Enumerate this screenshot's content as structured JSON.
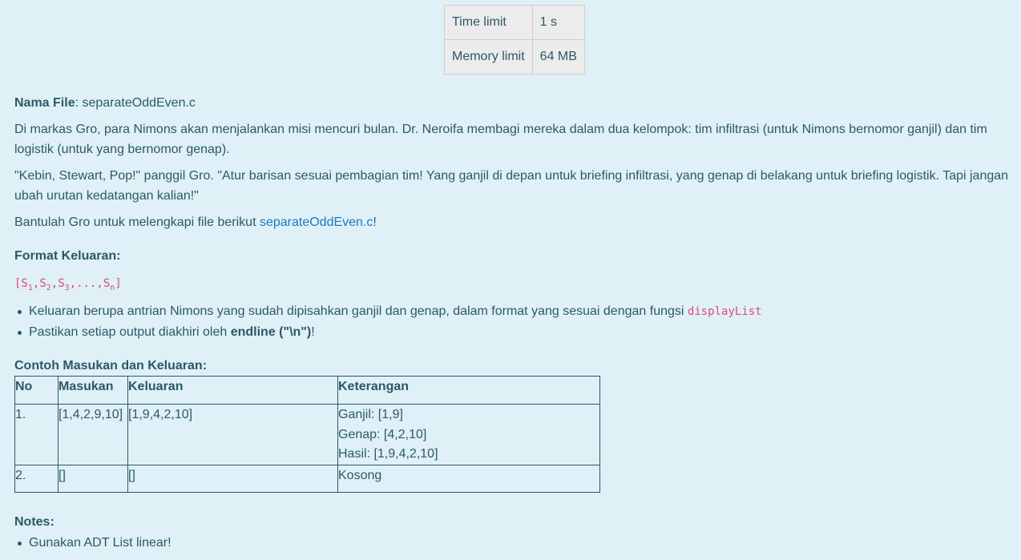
{
  "limits": {
    "time_label": "Time limit",
    "time_value": "1 s",
    "memory_label": "Memory limit",
    "memory_value": "64 MB"
  },
  "file": {
    "label": "Nama File",
    "name": ": separateOddEven.c"
  },
  "story": {
    "paragraph1": "Di markas Gro, para Nimons akan menjalankan misi mencuri bulan. Dr. Neroifa membagi mereka dalam dua kelompok: tim infiltrasi (untuk Nimons bernomor ganjil) dan tim logistik (untuk yang bernomor genap).",
    "paragraph2": "\"Kebin, Stewart, Pop!\" panggil Gro. \"Atur barisan sesuai pembagian tim! Yang ganjil di depan untuk briefing infiltrasi, yang genap di belakang untuk briefing logistik. Tapi jangan ubah urutan kedatangan kalian!\"",
    "paragraph3_prefix": "Bantulah Gro untuk melengkapi file berikut ",
    "paragraph3_link": "separateOddEven.c",
    "paragraph3_suffix": "!"
  },
  "output_format": {
    "heading": "Format Keluaran:",
    "format_open": "[S",
    "sub1": "1",
    "sep1": ",S",
    "sub2": "2",
    "sep2": ",S",
    "sub3": "3",
    "sep3": ",...,S",
    "subn": "n",
    "format_close": "]",
    "bullet1_text": "Keluaran berupa antrian Nimons yang sudah dipisahkan ganjil dan genap, dalam format yang sesuai dengan fungsi ",
    "bullet1_code": "displayList",
    "bullet2_prefix": "Pastikan setiap output diakhiri oleh ",
    "bullet2_bold": "endline (\"\\n\")",
    "bullet2_suffix": "!"
  },
  "samples": {
    "heading": "Contoh Masukan dan Keluaran:",
    "headers": {
      "no": "No",
      "input": "Masukan",
      "output": "Keluaran",
      "note": "Keterangan"
    },
    "rows": [
      {
        "no": "1.",
        "input": "[1,4,2,9,10]",
        "output": "[1,9,4,2,10]",
        "note_lines": [
          "Ganjil: [1,9]",
          "Genap: [4,2,10]",
          "Hasil: [1,9,4,2,10]"
        ]
      },
      {
        "no": "2.",
        "input": "[]",
        "output": "[]",
        "note_lines": [
          "Kosong"
        ]
      }
    ]
  },
  "notes": {
    "heading": "Notes:",
    "item1": "Gunakan ADT List linear!"
  }
}
